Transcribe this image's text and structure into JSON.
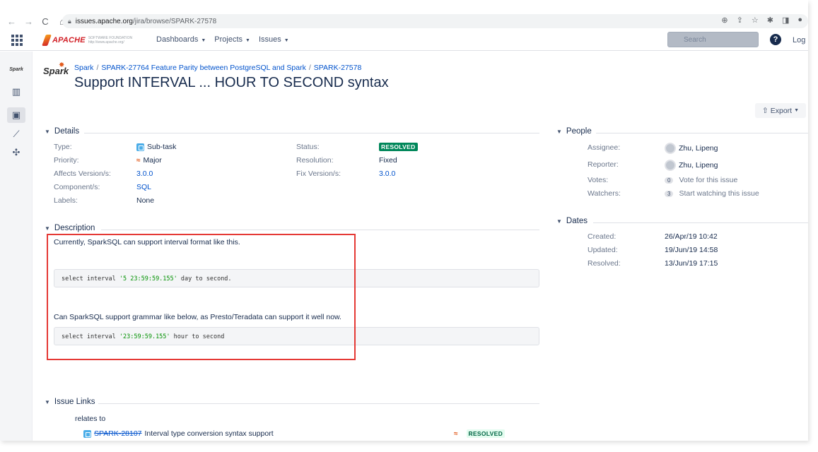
{
  "browser": {
    "url_host": "issues.apache.org",
    "url_path": "/jira/browse/SPARK-27578"
  },
  "header": {
    "logo_text": "APACHE",
    "logo_sub": "SOFTWARE FOUNDATION http://www.apache.org/",
    "nav": [
      {
        "label": "Dashboards"
      },
      {
        "label": "Projects"
      },
      {
        "label": "Issues"
      }
    ],
    "search_placeholder": "Search",
    "login_label": "Log"
  },
  "project": {
    "logo_text": "Spark"
  },
  "breadcrumb": {
    "project": "Spark",
    "parent": "SPARK-27764 Feature Parity between PostgreSQL and Spark",
    "issue": "SPARK-27578"
  },
  "issue": {
    "title": "Support INTERVAL ... HOUR TO SECOND syntax",
    "export_label": "Export"
  },
  "details": {
    "heading": "Details",
    "type_label": "Type:",
    "type_value": "Sub-task",
    "priority_label": "Priority:",
    "priority_value": "Major",
    "affects_label": "Affects Version/s:",
    "affects_value": "3.0.0",
    "component_label": "Component/s:",
    "component_value": "SQL",
    "labels_label": "Labels:",
    "labels_value": "None",
    "status_label": "Status:",
    "status_value": "RESOLVED",
    "resolution_label": "Resolution:",
    "resolution_value": "Fixed",
    "fix_label": "Fix Version/s:",
    "fix_value": "3.0.0"
  },
  "description": {
    "heading": "Description",
    "line1": "Currently, SparkSQL can support interval format like this.",
    "code1_pre": "select interval ",
    "code1_str": "'5 23:59:59.155'",
    "code1_post": " day to second.",
    "line2": "Can SparkSQL support grammar like below, as Presto/Teradata can support it well now.",
    "code2_pre": "select interval ",
    "code2_str": "'23:59:59.155'",
    "code2_post": "  hour to second"
  },
  "people": {
    "heading": "People",
    "assignee_label": "Assignee:",
    "assignee_value": "Zhu, Lipeng",
    "reporter_label": "Reporter:",
    "reporter_value": "Zhu, Lipeng",
    "votes_label": "Votes:",
    "votes_count": "0",
    "votes_link": "Vote for this issue",
    "watchers_label": "Watchers:",
    "watchers_count": "3",
    "watchers_link": "Start watching this issue"
  },
  "dates": {
    "heading": "Dates",
    "created_label": "Created:",
    "created_value": "26/Apr/19 10:42",
    "updated_label": "Updated:",
    "updated_value": "19/Jun/19 14:58",
    "resolved_label": "Resolved:",
    "resolved_value": "13/Jun/19 17:15"
  },
  "issue_links": {
    "heading": "Issue Links",
    "relation": "relates to",
    "link_key": "SPARK-28107",
    "link_title": "Interval type conversion syntax support",
    "link_status": "RESOLVED"
  },
  "colors": {
    "accent": "#0052cc",
    "resolved": "#00875a",
    "highlight_box": "#e53935"
  }
}
